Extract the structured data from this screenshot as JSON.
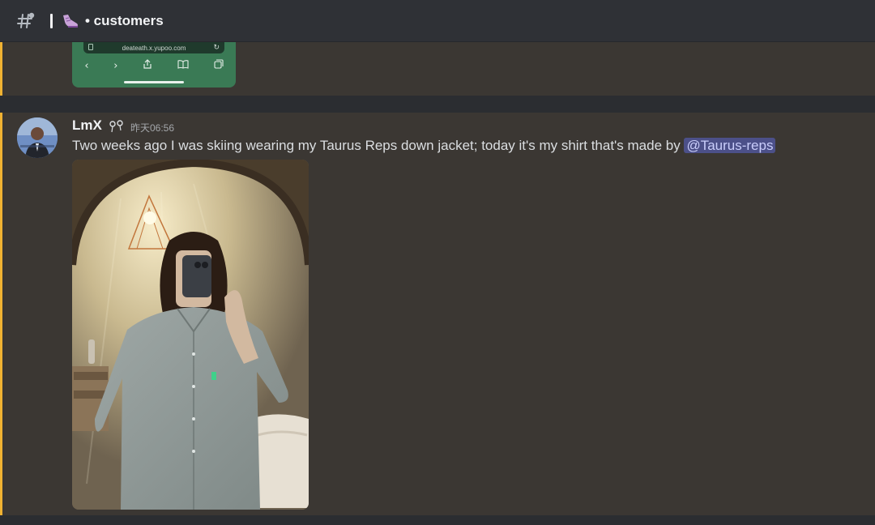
{
  "header": {
    "title": "• customers",
    "icons": [
      "thread-hash-icon",
      "sneaker-icon"
    ]
  },
  "previous_attachment": {
    "url": "deateath.x.yupoo.com"
  },
  "message": {
    "username": "LmX",
    "timestamp": "昨天06:56",
    "text": "Two weeks ago I was skiing wearing my Taurus Reps down jacket; today it's my shirt that's made by ",
    "mention": "@Taurus-reps"
  },
  "colors": {
    "highlight_bar": "#f0b232",
    "mention_bg": "#4c5089",
    "header_bg": "#2f3136",
    "message_bg": "#3b3733"
  }
}
